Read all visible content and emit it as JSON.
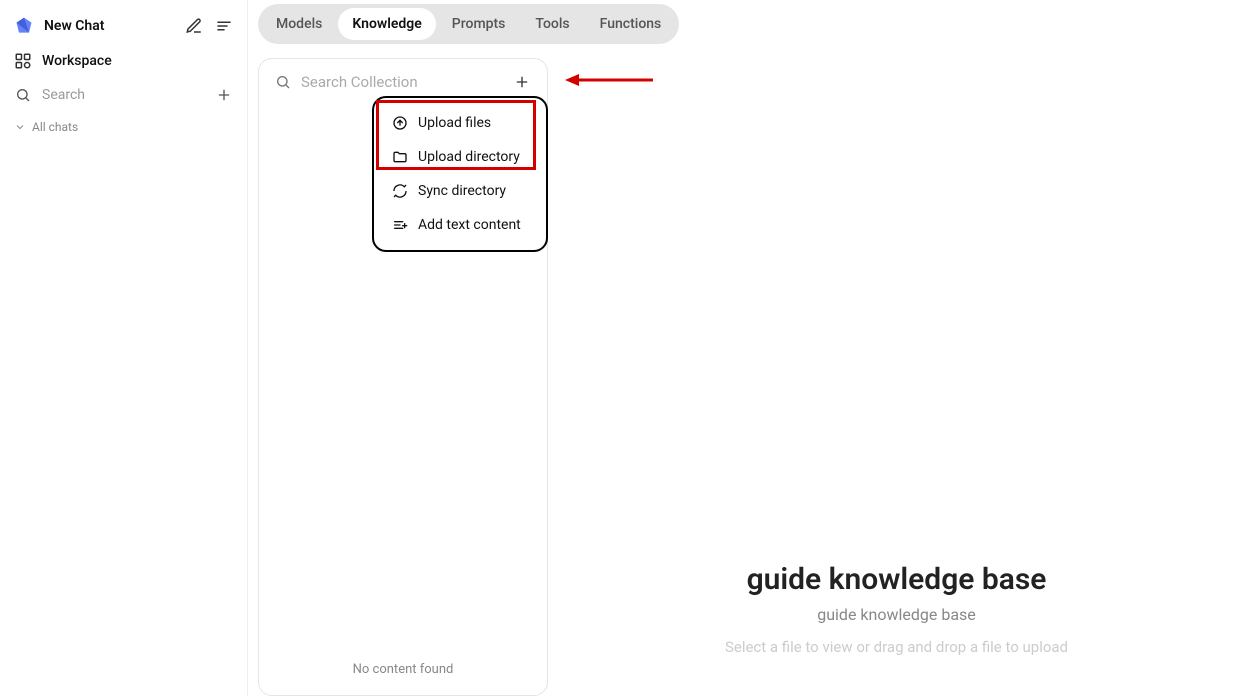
{
  "sidebar": {
    "new_chat": "New Chat",
    "workspace": "Workspace",
    "search_placeholder": "Search",
    "all_chats": "All chats"
  },
  "tabs": {
    "models": "Models",
    "knowledge": "Knowledge",
    "prompts": "Prompts",
    "tools": "Tools",
    "functions": "Functions"
  },
  "collection": {
    "search_placeholder": "Search Collection",
    "no_content": "No content found"
  },
  "dropdown": {
    "upload_files": "Upload files",
    "upload_directory": "Upload directory",
    "sync_directory": "Sync directory",
    "add_text": "Add text content"
  },
  "detail": {
    "title": "guide knowledge base",
    "subtitle": "guide knowledge base",
    "hint": "Select a file to view or drag and drop a file to upload"
  }
}
